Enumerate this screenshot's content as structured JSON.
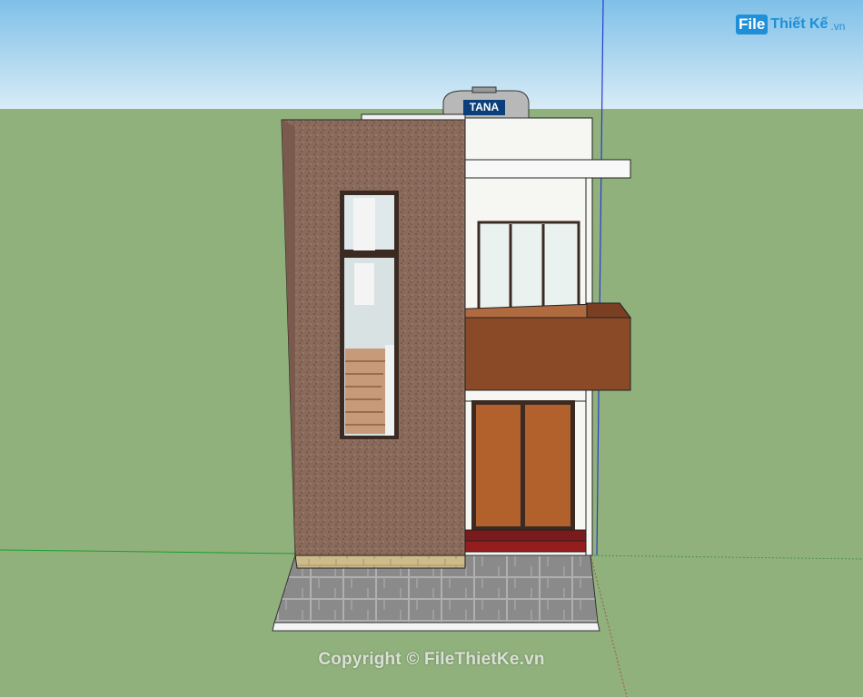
{
  "watermark": {
    "logo_box": "File",
    "logo_text": "Thiết Kế",
    "logo_suffix": ".vn",
    "copyright": "Copyright © FileThietKe.vn"
  },
  "tank": {
    "brand": "TANA"
  },
  "colors": {
    "sky": "#7fc0e8",
    "ground": "#90b07c",
    "stone_wall": "#8a6a5a",
    "white_wall": "#f5f5f0",
    "balcony": "#8a4a2a",
    "door": "#b0602a",
    "paving": "#8c8c8c",
    "step": "#7a1a1a"
  }
}
